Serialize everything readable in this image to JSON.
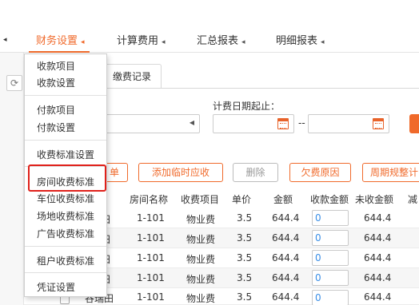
{
  "nav": {
    "items": [
      {
        "label": "财务设置",
        "active": true
      },
      {
        "label": "计算费用"
      },
      {
        "label": "汇总报表"
      },
      {
        "label": "明细报表"
      }
    ],
    "arrow_glyph": "◂",
    "accent_color": "#f06a2b"
  },
  "tabs": [
    {
      "label": "缴费记录"
    }
  ],
  "filters": {
    "date_label": "计费日期起止：",
    "date_separator": "--"
  },
  "actions": [
    {
      "label": "单"
    },
    {
      "label": "添加临时应收"
    },
    {
      "label": "删除",
      "disabled": true
    },
    {
      "label": "欠费原因"
    },
    {
      "label": "周期规整计"
    }
  ],
  "table": {
    "columns": [
      "房间名称",
      "收费项目",
      "单价",
      "金额",
      "收款金额",
      "未收金额",
      "减"
    ],
    "rows": [
      {
        "prefix": "田",
        "room": "1-101",
        "item": "物业费",
        "price": "3.5",
        "amount": "644.4",
        "received": "0",
        "unpaid": "644.4"
      },
      {
        "prefix": "田",
        "room": "1-101",
        "item": "物业费",
        "price": "3.5",
        "amount": "644.4",
        "received": "0",
        "unpaid": "644.4"
      },
      {
        "prefix": "田",
        "room": "1-101",
        "item": "物业费",
        "price": "3.5",
        "amount": "644.4",
        "received": "0",
        "unpaid": "644.4"
      },
      {
        "prefix": "田",
        "room": "1-101",
        "item": "物业费",
        "price": "3.5",
        "amount": "644.4",
        "received": "0",
        "unpaid": "644.4"
      },
      {
        "prefix": "田",
        "room": "1-101",
        "item": "物业费",
        "price": "3.5",
        "amount": "644.4",
        "received": "0",
        "unpaid": "644.4"
      },
      {
        "prefix": "谷瑞田",
        "room": "1-101",
        "item": "物业费",
        "price": "3.5",
        "amount": "644.4",
        "received": "0",
        "unpaid": "644.4"
      }
    ]
  },
  "dropdown": {
    "items": [
      {
        "label": "收款项目"
      },
      {
        "label": "收款设置"
      },
      {
        "label": "付款项目"
      },
      {
        "label": "付款设置"
      },
      {
        "label": "收费标准设置"
      },
      {
        "label": "房间收费标准",
        "highlighted": true
      },
      {
        "label": "车位收费标准"
      },
      {
        "label": "场地收费标准"
      },
      {
        "label": "广告收费标准"
      },
      {
        "label": "租户收费标准"
      },
      {
        "label": "凭证设置"
      }
    ],
    "highlight_color": "#e0201a"
  }
}
